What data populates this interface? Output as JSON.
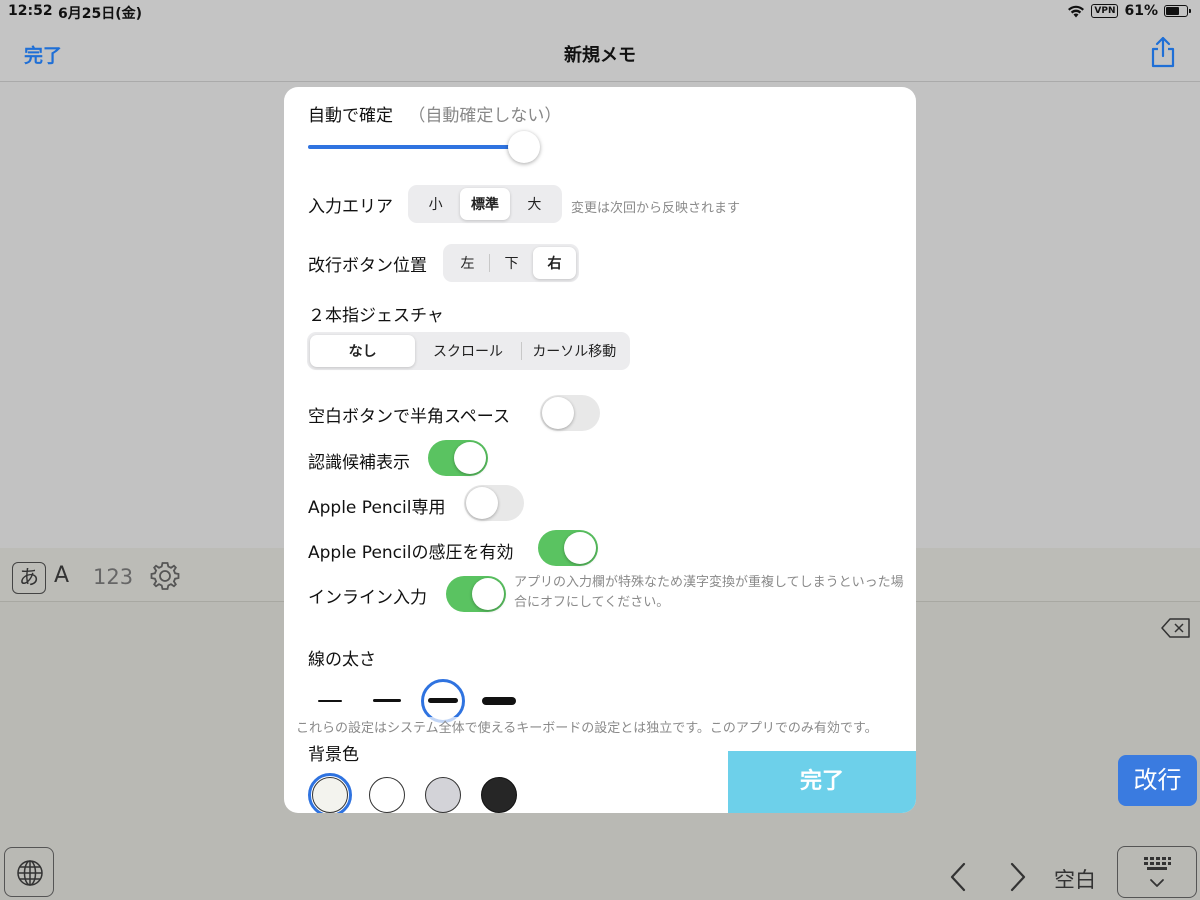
{
  "status": {
    "time": "12:52",
    "date": "6月25日(金)",
    "vpn": "VPN",
    "battery": "61%",
    "battery_level": 0.61
  },
  "nav": {
    "done": "完了",
    "title": "新規メモ"
  },
  "settings": {
    "auto_confirm": {
      "label": "自動で確定",
      "sublabel": "（自動確定しない）",
      "value": 1.0
    },
    "input_area": {
      "label": "入力エリア",
      "options": [
        "小",
        "標準",
        "大"
      ],
      "selected": "標準",
      "note": "変更は次回から反映されます"
    },
    "newline_pos": {
      "label": "改行ボタン位置",
      "options": [
        "左",
        "下",
        "右"
      ],
      "selected": "右"
    },
    "two_finger": {
      "label": "２本指ジェスチャ",
      "options": [
        "なし",
        "スクロール",
        "カーソル移動"
      ],
      "selected": "なし"
    },
    "space_half": {
      "label": "空白ボタンで半角スペース",
      "on": false
    },
    "candidates": {
      "label": "認識候補表示",
      "on": true
    },
    "pencil_only": {
      "label": "Apple Pencil専用",
      "on": false
    },
    "pencil_pressure": {
      "label": "Apple Pencilの感圧を有効",
      "on": true
    },
    "inline_input": {
      "label": "インライン入力",
      "on": true,
      "note": "アプリの入力欄が特殊なため漢字変換が重複してしまうといった場合にオフにしてください。"
    },
    "line_width": {
      "label": "線の太さ",
      "options": [
        "極細",
        "細",
        "中",
        "太"
      ],
      "selected_index": 2
    },
    "footer_note": "これらの設定はシステム全体で使えるキーボードの設定とは独立です。このアプリでのみ有効です。",
    "bg_color": {
      "label": "背景色",
      "colors": [
        "#f3f3ee",
        "#ffffff",
        "#d3d3d8",
        "#262626"
      ],
      "selected_index": 0
    },
    "done_button": "完了"
  },
  "keyboard": {
    "kana": "あ",
    "latin": "A",
    "numbers": "123",
    "return": "改行",
    "space": "空白"
  }
}
